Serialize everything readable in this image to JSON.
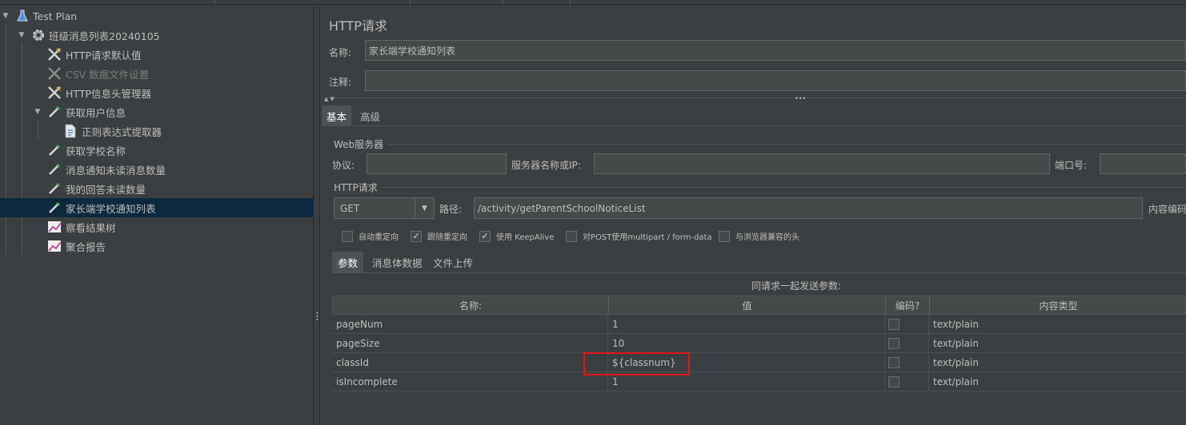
{
  "tree": {
    "items": [
      {
        "label": "Test Plan",
        "icon": "flask-icon",
        "expanded": true
      },
      {
        "label": "班级消息列表20240105",
        "icon": "gear-icon",
        "expanded": true
      },
      {
        "label": "HTTP请求默认值",
        "icon": "wrench-icon"
      },
      {
        "label": "CSV 数据文件设置",
        "icon": "wrench-icon",
        "disabled": true
      },
      {
        "label": "HTTP信息头管理器",
        "icon": "wrench-icon"
      },
      {
        "label": "获取用户信息",
        "icon": "pipette-icon",
        "expanded": true
      },
      {
        "label": "正则表达式提取器",
        "icon": "document-icon"
      },
      {
        "label": "获取学校名称",
        "icon": "pipette-icon"
      },
      {
        "label": "消息通知未读消息数量",
        "icon": "pipette-icon"
      },
      {
        "label": "我的回答未读数量",
        "icon": "pipette-icon"
      },
      {
        "label": "家长端学校通知列表",
        "icon": "pipette-icon",
        "selected": true
      },
      {
        "label": "察看结果树",
        "icon": "chart-icon"
      },
      {
        "label": "聚合报告",
        "icon": "chart-icon"
      }
    ]
  },
  "panel": {
    "title": "HTTP请求",
    "name_label": "名称:",
    "name_value": "家长端学校通知列表",
    "comment_label": "注释:",
    "comment_value": "",
    "tabs": [
      "基本",
      "高级"
    ],
    "web_server": {
      "title": "Web服务器",
      "protocol_label": "协议:",
      "protocol_value": "",
      "server_label": "服务器名称或IP:",
      "server_value": "",
      "port_label": "端口号:",
      "port_value": ""
    },
    "http_request": {
      "title": "HTTP请求",
      "method": "GET",
      "path_label": "路径:",
      "path_value": "/activity/getParentSchoolNoticeList",
      "encoding_label": "内容编码"
    },
    "options": [
      {
        "label": "自动重定向",
        "checked": false
      },
      {
        "label": "跟随重定向",
        "checked": true
      },
      {
        "label": "使用 KeepAlive",
        "checked": true
      },
      {
        "label": "对POST使用multipart / form-data",
        "checked": false
      },
      {
        "label": "与浏览器兼容的头",
        "checked": false
      }
    ],
    "param_tabs": [
      "参数",
      "消息体数据",
      "文件上传"
    ],
    "params_caption": "同请求一起发送参数:",
    "columns": [
      "名称:",
      "值",
      "编码?",
      "内容类型"
    ],
    "rows": [
      {
        "name": "pageNum",
        "value": "1",
        "encode": false,
        "content_type": "text/plain"
      },
      {
        "name": "pageSize",
        "value": "10",
        "encode": false,
        "content_type": "text/plain"
      },
      {
        "name": "classId",
        "value": "${classnum}",
        "encode": false,
        "content_type": "text/plain"
      },
      {
        "name": "isIncomplete",
        "value": "1",
        "encode": false,
        "content_type": "text/plain"
      }
    ]
  },
  "colors": {
    "background": "#3c3f41",
    "selection": "#0d293e",
    "highlight_box": "#e0161c"
  }
}
